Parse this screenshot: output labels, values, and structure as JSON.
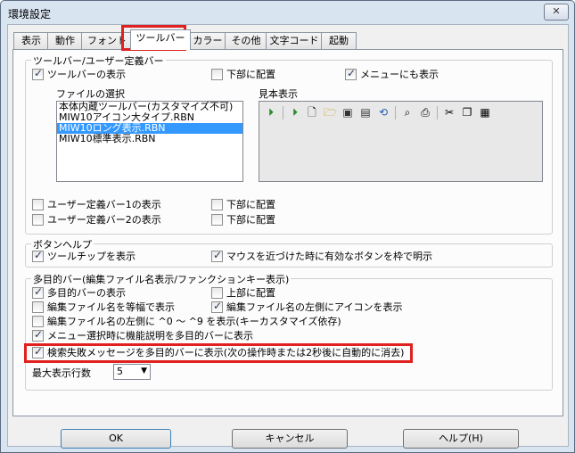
{
  "window": {
    "title": "環境設定",
    "close": "✕"
  },
  "tabs": [
    {
      "label": "表示"
    },
    {
      "label": "動作"
    },
    {
      "label": "フォント"
    },
    {
      "label": "ツールバー"
    },
    {
      "label": "カラー"
    },
    {
      "label": "その他"
    },
    {
      "label": "文字コード"
    },
    {
      "label": "起動"
    }
  ],
  "toolbar_group": {
    "label": "ツールバー/ユーザー定義バー",
    "show_toolbar": "ツールバーの表示",
    "bottom_place": "下部に配置",
    "menu_show": "メニューにも表示",
    "file_select_label": "ファイルの選択",
    "files": [
      "本体内蔵ツールバー(カスタマイズ不可)",
      "MIW10アイコン大タイプ.RBN",
      "MIW10ロング表示.RBN",
      "MIW10標準表示.RBN"
    ],
    "preview_label": "見本表示",
    "user_bar1": "ユーザー定義バー1の表示",
    "user_bar2": "ユーザー定義バー2の表示",
    "bottom_place1": "下部に配置",
    "bottom_place2": "下部に配置"
  },
  "button_help_group": {
    "label": "ボタンヘルプ",
    "tooltip": "ツールチップを表示",
    "mouse_hover": "マウスを近づけた時に有効なボタンを枠で明示"
  },
  "multi_bar_group": {
    "label": "多目的バー(編集ファイル名表示/ファンクションキー表示)",
    "show_multi": "多目的バーの表示",
    "top_place": "上部に配置",
    "equal_width": "編集ファイル名を等幅で表示",
    "icon_left": "編集ファイル名の左側にアイコンを表示",
    "shortcut": "編集ファイル名の左側に ^0 ～ ^9 を表示(キーカスタマイズ依存)",
    "menu_desc": "メニュー選択時に機能説明を多目的バーに表示",
    "search_fail": "検索失敗メッセージを多目的バーに表示(次の操作時または2秒後に自動的に消去)",
    "max_lines_label": "最大表示行数",
    "max_lines_value": "5"
  },
  "buttons": {
    "ok": "OK",
    "cancel": "キャンセル",
    "help": "ヘルプ(H)"
  },
  "colors": {
    "highlight": "#e0211f",
    "selection": "#3399ff"
  }
}
